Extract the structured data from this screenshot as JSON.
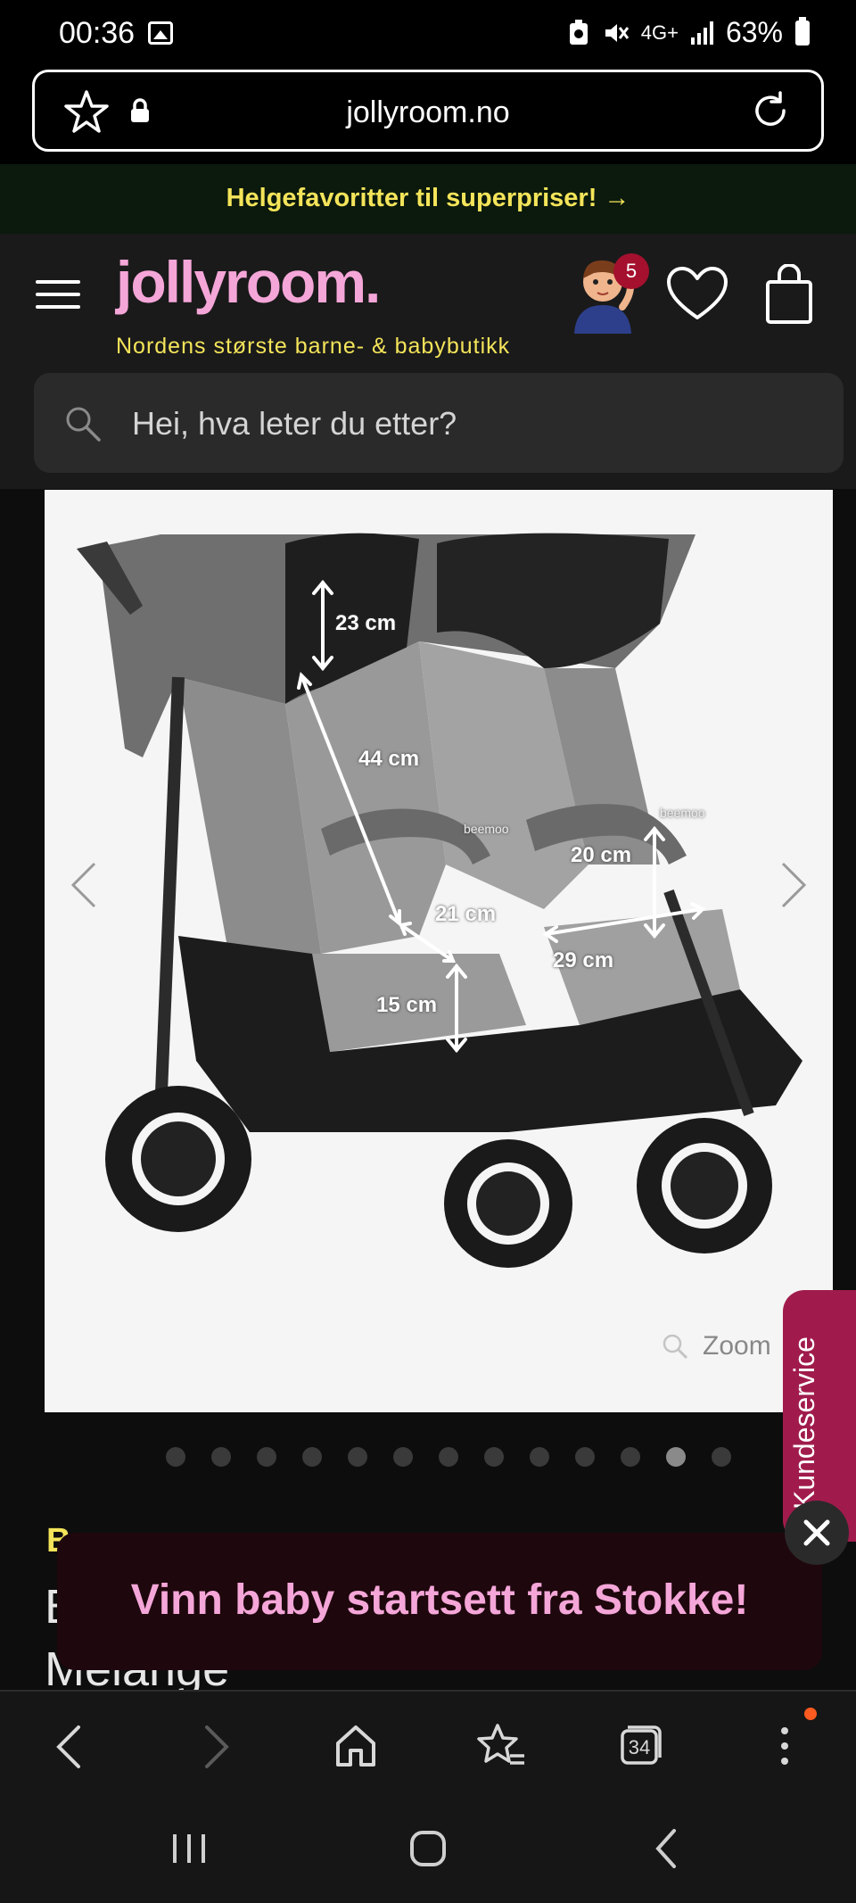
{
  "status_bar": {
    "time": "00:36",
    "network": "4G+",
    "battery": "63%"
  },
  "browser": {
    "url": "jollyroom.no"
  },
  "promo": {
    "text": "Helgefavoritter til superpriser! →"
  },
  "site": {
    "logo": "jollyroom.",
    "tagline": "Nordens største barne- & babybutikk",
    "avatar_badge": "5",
    "search_placeholder": "Hei, hva leter du etter?"
  },
  "product_image": {
    "measurements": [
      "23 cm",
      "44 cm",
      "21 cm",
      "15 cm",
      "20 cm",
      "29 cm"
    ],
    "brand_on_bumper": "beemoo",
    "zoom_label": "Zoom",
    "carousel_total": 13,
    "carousel_active_index": 11
  },
  "customer_service": {
    "label": "Kundeservice"
  },
  "product": {
    "brand_partial": "B",
    "title_line1_partial": "B",
    "title_line2_partial": "Melange"
  },
  "popup": {
    "text": "Vinn baby startsett fra Stokke!"
  },
  "toolbar": {
    "tabs_count": "34"
  },
  "colors": {
    "brand_pink": "#f5a6d8",
    "brand_yellow": "#f4e45a",
    "service_tab": "#a01b4c",
    "notification_dot": "#ff5a1f"
  }
}
